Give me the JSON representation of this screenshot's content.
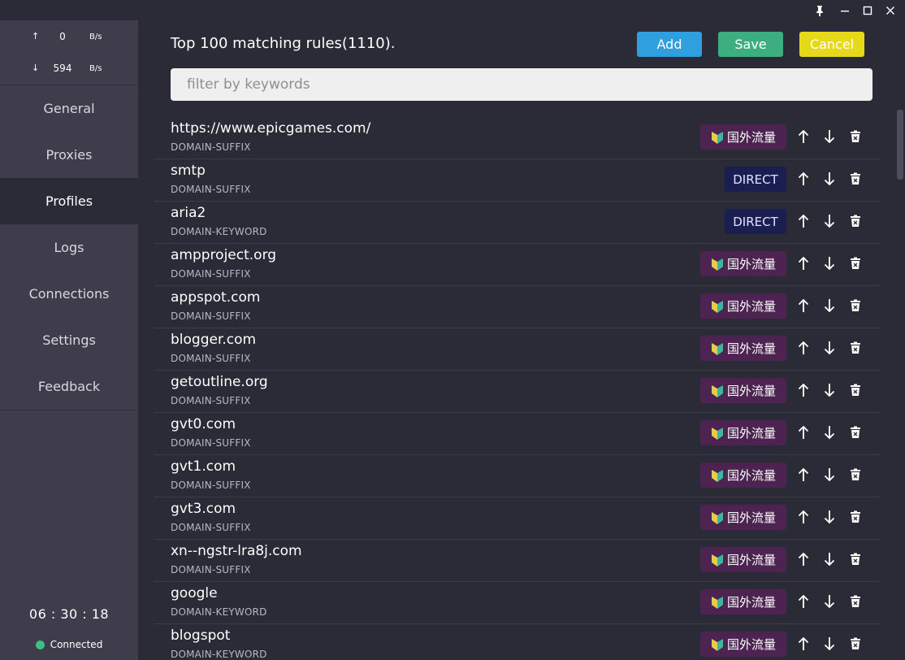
{
  "window": {
    "pin_icon": "pin-icon",
    "minimize_icon": "minimize-icon",
    "maximize_icon": "maximize-icon",
    "close_icon": "close-icon"
  },
  "traffic": {
    "up_arrow": "↑",
    "up_value": "0",
    "up_unit": "B/s",
    "down_arrow": "↓",
    "down_value": "594",
    "down_unit": "B/s"
  },
  "nav": [
    {
      "label": "General"
    },
    {
      "label": "Proxies"
    },
    {
      "label": "Profiles",
      "active": true
    },
    {
      "label": "Logs"
    },
    {
      "label": "Connections"
    },
    {
      "label": "Settings"
    },
    {
      "label": "Feedback"
    }
  ],
  "status": {
    "clock": "06 : 30 : 18",
    "connection": "Connected",
    "connection_color": "#3dbf84"
  },
  "header": {
    "title": "Top 100 matching rules(1110).",
    "add_label": "Add",
    "save_label": "Save",
    "cancel_label": "Cancel"
  },
  "search": {
    "placeholder": "filter by keywords",
    "value": ""
  },
  "colors": {
    "add": "#2f9fe0",
    "save": "#3dae7f",
    "cancel": "#e6d91a",
    "proxy_tag": "#4d2451",
    "direct_tag": "#1b1e50"
  },
  "rules": [
    {
      "name": "https://www.epicgames.com/",
      "type": "DOMAIN-SUFFIX",
      "policy": "国外流量",
      "kind": "proxy"
    },
    {
      "name": "smtp",
      "type": "DOMAIN-SUFFIX",
      "policy": "DIRECT",
      "kind": "direct"
    },
    {
      "name": "aria2",
      "type": "DOMAIN-KEYWORD",
      "policy": "DIRECT",
      "kind": "direct"
    },
    {
      "name": "ampproject.org",
      "type": "DOMAIN-SUFFIX",
      "policy": "国外流量",
      "kind": "proxy"
    },
    {
      "name": "appspot.com",
      "type": "DOMAIN-SUFFIX",
      "policy": "国外流量",
      "kind": "proxy"
    },
    {
      "name": "blogger.com",
      "type": "DOMAIN-SUFFIX",
      "policy": "国外流量",
      "kind": "proxy"
    },
    {
      "name": "getoutline.org",
      "type": "DOMAIN-SUFFIX",
      "policy": "国外流量",
      "kind": "proxy"
    },
    {
      "name": "gvt0.com",
      "type": "DOMAIN-SUFFIX",
      "policy": "国外流量",
      "kind": "proxy"
    },
    {
      "name": "gvt1.com",
      "type": "DOMAIN-SUFFIX",
      "policy": "国外流量",
      "kind": "proxy"
    },
    {
      "name": "gvt3.com",
      "type": "DOMAIN-SUFFIX",
      "policy": "国外流量",
      "kind": "proxy"
    },
    {
      "name": "xn--ngstr-lra8j.com",
      "type": "DOMAIN-SUFFIX",
      "policy": "国外流量",
      "kind": "proxy"
    },
    {
      "name": "google",
      "type": "DOMAIN-KEYWORD",
      "policy": "国外流量",
      "kind": "proxy"
    },
    {
      "name": "blogspot",
      "type": "DOMAIN-KEYWORD",
      "policy": "国外流量",
      "kind": "proxy"
    }
  ]
}
